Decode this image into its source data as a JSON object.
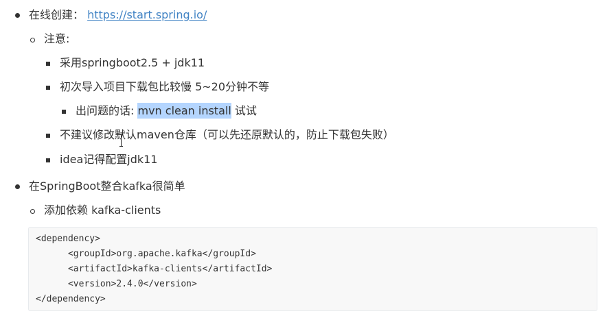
{
  "list": {
    "item1": {
      "label": "在线创建：",
      "link": "https://start.spring.io/"
    },
    "note": {
      "label": "注意:"
    },
    "note_items": [
      "采用springboot2.5 + jdk11",
      "初次导入项目下载包比较慢 5~20分钟不等"
    ],
    "issue": {
      "prefix": "出问题的话: ",
      "highlighted": "mvn clean install",
      "suffix": " 试试"
    },
    "note_items_2": [
      "不建议修改默认maven仓库（可以先还原默认的，防止下载包失败）",
      "idea记得配置jdk11"
    ],
    "item2": {
      "label": "在SpringBoot整合kafka很简单"
    },
    "dependency": {
      "label": "添加依赖 kafka-clients"
    }
  },
  "code": {
    "lines": [
      "<dependency>",
      "      <groupId>org.apache.kafka</groupId>",
      "      <artifactId>kafka-clients</artifactId>",
      "      <version>2.4.0</version>",
      "</dependency>"
    ]
  },
  "colors": {
    "link": "#4183c4",
    "highlight": "#b4d5fe",
    "code_background": "#f8f8f8"
  }
}
